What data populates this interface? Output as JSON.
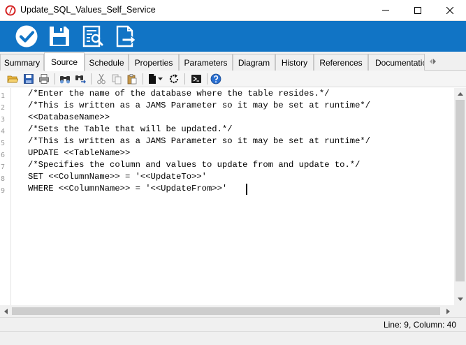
{
  "window": {
    "title": "Update_SQL_Values_Self_Service",
    "minimize_icon": "minimize-icon",
    "maximize_icon": "maximize-icon",
    "close_icon": "close-icon"
  },
  "ribbon": {
    "background": "#1174c5",
    "buttons": [
      {
        "name": "save-close",
        "icon": "checkmark-circle-icon"
      },
      {
        "name": "save",
        "icon": "floppy-disk-icon"
      },
      {
        "name": "view",
        "icon": "document-search-icon"
      },
      {
        "name": "export",
        "icon": "document-export-icon"
      }
    ]
  },
  "tabs": [
    {
      "label": "Summary",
      "active": false
    },
    {
      "label": "Source",
      "active": true
    },
    {
      "label": "Schedule",
      "active": false
    },
    {
      "label": "Properties",
      "active": false
    },
    {
      "label": "Parameters",
      "active": false
    },
    {
      "label": "Diagram",
      "active": false
    },
    {
      "label": "History",
      "active": false
    },
    {
      "label": "References",
      "active": false
    },
    {
      "label": "Documentation",
      "active": false
    }
  ],
  "toolbar": {
    "icons": [
      "open-folder-icon",
      "save-icon",
      "print-icon",
      "find-icon",
      "replace-icon",
      "cut-icon",
      "copy-icon",
      "paste-icon",
      "new-document-icon",
      "refresh-icon",
      "powershell-icon",
      "help-icon"
    ]
  },
  "editor": {
    "lines": [
      {
        "num": "1",
        "text": "/*Enter the name of the database where the table resides.*/"
      },
      {
        "num": "2",
        "text": "/*This is written as a JAMS Parameter so it may be set at runtime*/"
      },
      {
        "num": "3",
        "text": "<<DatabaseName>>"
      },
      {
        "num": "4",
        "text": "/*Sets the Table that will be updated.*/"
      },
      {
        "num": "5",
        "text": "/*This is written as a JAMS Parameter so it may be set at runtime*/"
      },
      {
        "num": "6",
        "text": "UPDATE <<TableName>>"
      },
      {
        "num": "7",
        "text": "/*Specifies the column and values to update from and update to.*/"
      },
      {
        "num": "8",
        "text": "SET <<ColumnName>> = '<<UpdateTo>>'"
      },
      {
        "num": "9",
        "text": "WHERE <<ColumnName>> = '<<UpdateFrom>>'"
      }
    ]
  },
  "status": {
    "position": "Line: 9, Column: 40"
  }
}
